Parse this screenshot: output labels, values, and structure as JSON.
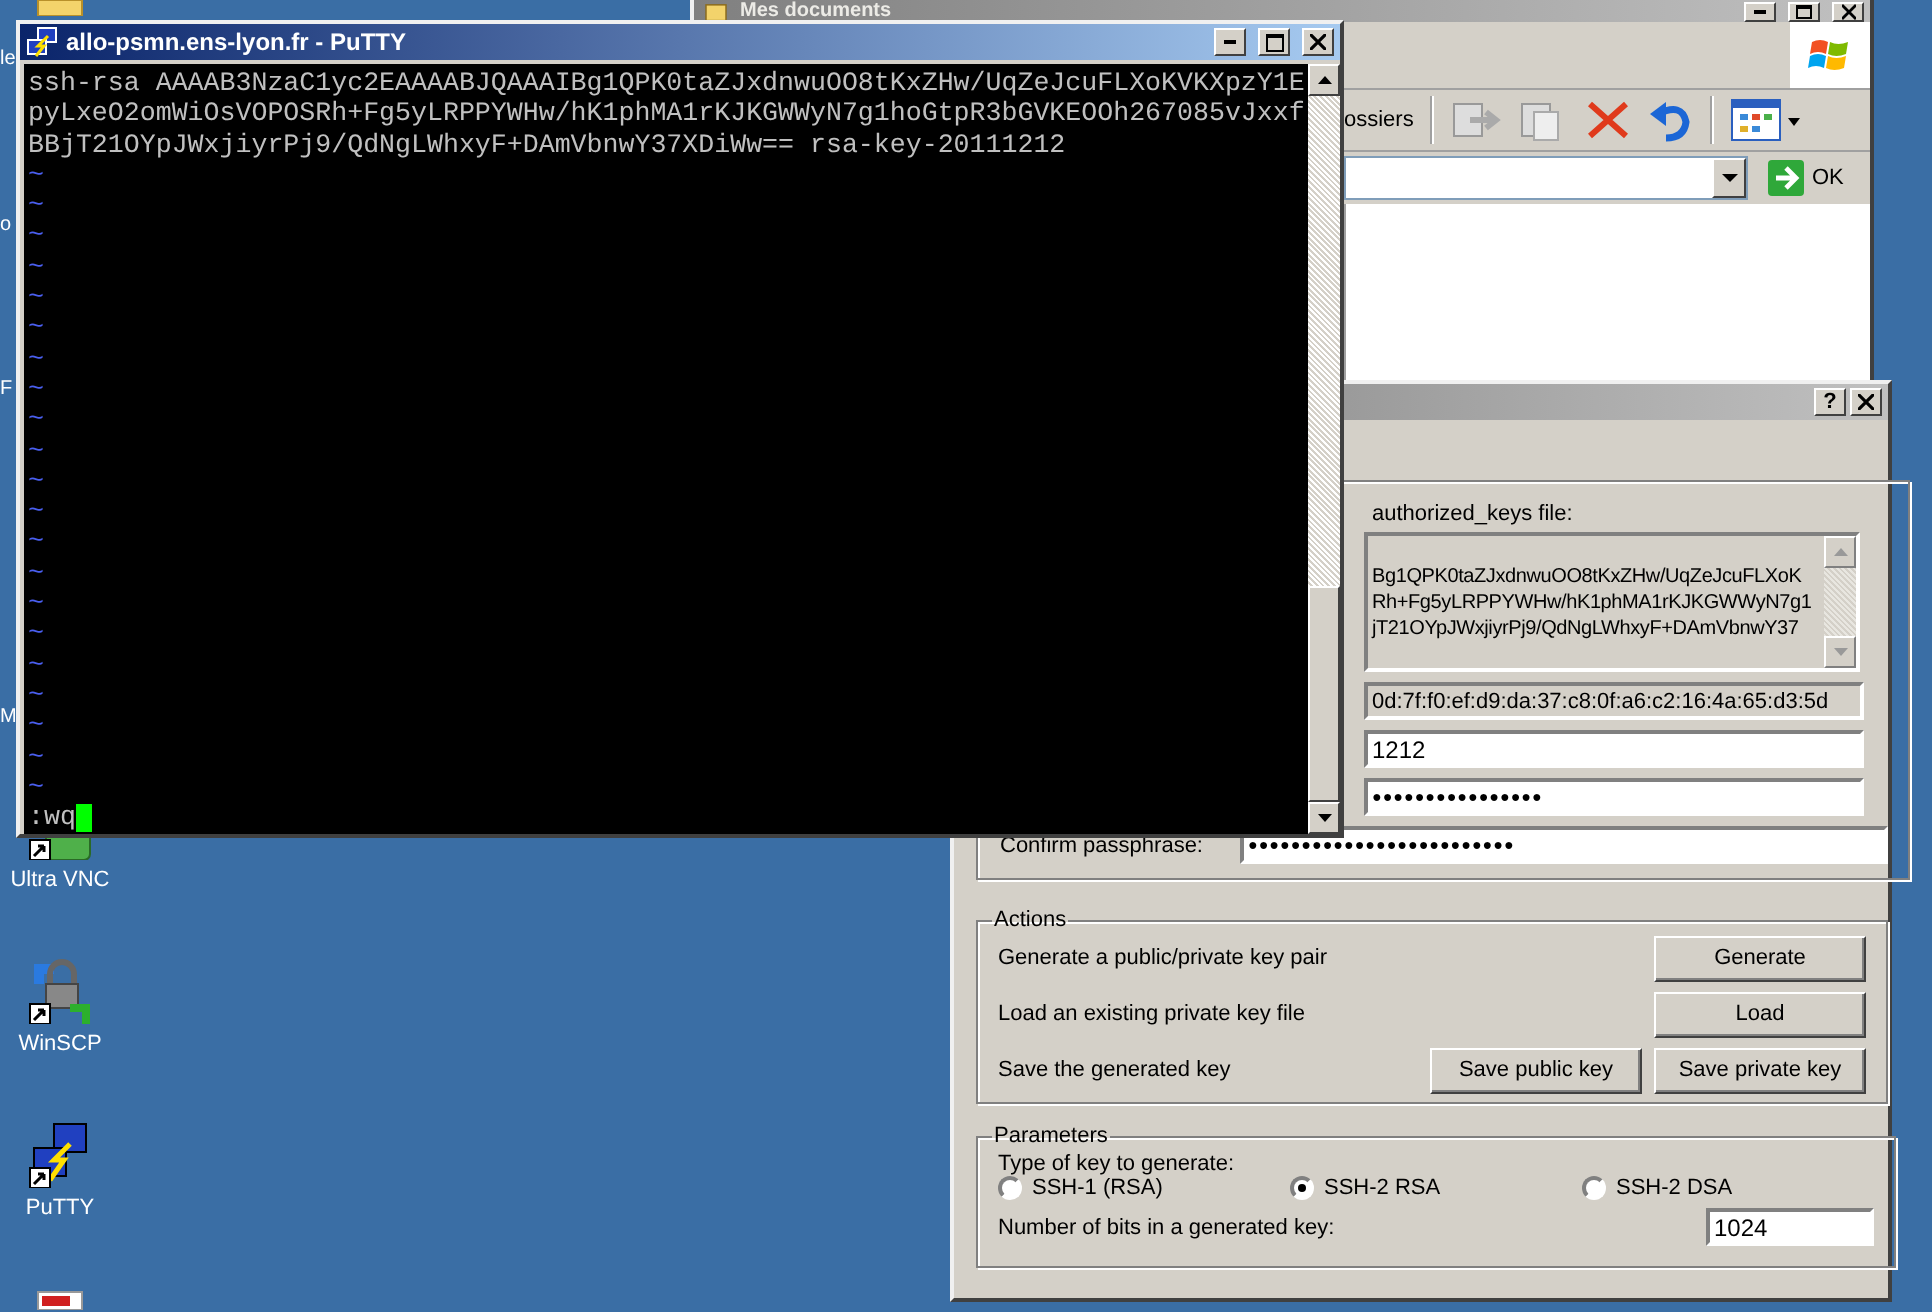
{
  "desktop": {
    "fragments": [
      "le",
      "o",
      "F",
      "M"
    ],
    "icons": [
      {
        "kind": "vnc",
        "label": "Ultra VNC"
      },
      {
        "kind": "winscp",
        "label": "WinSCP"
      },
      {
        "kind": "putty",
        "label": "PuTTY"
      }
    ]
  },
  "explorer": {
    "title": "Mes documents",
    "toolbar_label": "ossiers",
    "go_button": "OK"
  },
  "puttygen": {
    "help_button": "?",
    "key_box_label": "authorized_keys file:",
    "key_lines": [
      "Bg1QPK0taZJxdnwuOO8tKxZHw/UqZeJcuFLXoK",
      "Rh+Fg5yLRPPYWHw/hK1phMA1rKJKGWWyN7g1",
      "jT21OYpJWxjiyrPj9/QdNgLWhxyF+DAmVbnwY37"
    ],
    "fingerprint": "0d:7f:f0:ef:d9:da:37:c8:0f:a6:c2:16:4a:65:d3:5d",
    "comment": "1212",
    "passphrase": "●●●●●●●●●●●●●●●●",
    "confirm_label": "Confirm passphrase:",
    "confirm": "●●●●●●●●●●●●●●●●●●●●●●●●●",
    "actions": {
      "title": "Actions",
      "rows": [
        {
          "label": "Generate a public/private key pair",
          "buttons": [
            "Generate"
          ]
        },
        {
          "label": "Load an existing private key file",
          "buttons": [
            "Load"
          ]
        },
        {
          "label": "Save the generated key",
          "buttons": [
            "Save public key",
            "Save private key"
          ]
        }
      ]
    },
    "parameters": {
      "title": "Parameters",
      "type_label": "Type of key to generate:",
      "key_types": [
        {
          "label": "SSH-1 (RSA)",
          "selected": false
        },
        {
          "label": "SSH-2 RSA",
          "selected": true
        },
        {
          "label": "SSH-2 DSA",
          "selected": false
        }
      ],
      "bits_label": "Number of bits in a generated key:",
      "bits": "1024"
    }
  },
  "putty": {
    "title": "allo-psmn.ens-lyon.fr - PuTTY",
    "lines": [
      {
        "kind": "text",
        "text": "ssh-rsa AAAAB3NzaC1yc2EAAAABJQAAAIBg1QPK0taZJxdnwuOO8tKxZHw/UqZeJcuFLXoKVKXpzY1E"
      },
      {
        "kind": "text",
        "text": "pyLxeO2omWiOsVOPOSRh+Fg5yLRPPYWHw/hK1phMA1rKJKGWWyN7g1hoGtpR3bGVKEOOh267085vJxxf"
      },
      {
        "kind": "text",
        "text": "BBjT21OYpJWxjiyrPj9/QdNgLWhxyF+DAmVbnwY37XDiWw== rsa-key-20111212"
      },
      {
        "kind": "filler",
        "text": "~"
      },
      {
        "kind": "filler",
        "text": "~"
      },
      {
        "kind": "filler",
        "text": "~"
      },
      {
        "kind": "filler",
        "text": "~"
      },
      {
        "kind": "filler",
        "text": "~"
      },
      {
        "kind": "filler",
        "text": "~"
      },
      {
        "kind": "filler",
        "text": "~"
      },
      {
        "kind": "filler",
        "text": "~"
      },
      {
        "kind": "filler",
        "text": "~"
      },
      {
        "kind": "filler",
        "text": "~"
      },
      {
        "kind": "filler",
        "text": "~"
      },
      {
        "kind": "filler",
        "text": "~"
      },
      {
        "kind": "filler",
        "text": "~"
      },
      {
        "kind": "filler",
        "text": "~"
      },
      {
        "kind": "filler",
        "text": "~"
      },
      {
        "kind": "filler",
        "text": "~"
      },
      {
        "kind": "filler",
        "text": "~"
      },
      {
        "kind": "filler",
        "text": "~"
      },
      {
        "kind": "filler",
        "text": "~"
      },
      {
        "kind": "filler",
        "text": "~"
      },
      {
        "kind": "filler",
        "text": "~"
      }
    ],
    "command": ":wq"
  }
}
